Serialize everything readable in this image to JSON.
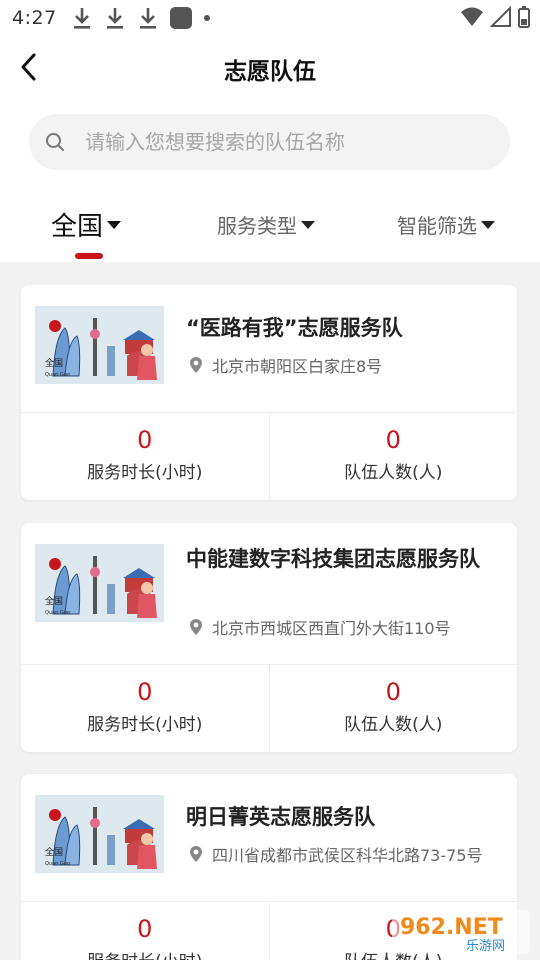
{
  "status_bar": {
    "time": "4:27"
  },
  "header": {
    "title": "志愿队伍"
  },
  "search": {
    "placeholder": "请输入您想要搜索的队伍名称"
  },
  "filters": [
    {
      "label": "全国",
      "active": true
    },
    {
      "label": "服务类型",
      "active": false
    },
    {
      "label": "智能筛选",
      "active": false
    }
  ],
  "teams": [
    {
      "name": "“医路有我”志愿服务队",
      "address": "北京市朝阳区白家庄8号",
      "hours_value": "0",
      "hours_label": "服务时长(小时)",
      "members_value": "0",
      "members_label": "队伍人数(人)"
    },
    {
      "name": "中能建数字科技集团志愿服务队",
      "address": "北京市西城区西直门外大街110号",
      "hours_value": "0",
      "hours_label": "服务时长(小时)",
      "members_value": "0",
      "members_label": "队伍人数(人)"
    },
    {
      "name": "明日菁英志愿服务队",
      "address": "四川省成都市武侯区科华北路73-75号",
      "hours_value": "0",
      "hours_label": "服务时长(小时)",
      "members_value": "0",
      "members_label": "队伍人数(人)"
    }
  ],
  "thumbnail": {
    "caption": "全国",
    "subcaption": "Quan Guo"
  },
  "watermark": {
    "brand": "962.NET",
    "sub": "乐游网"
  },
  "colors": {
    "accent": "#c8151b",
    "background": "#f2f2f2"
  }
}
